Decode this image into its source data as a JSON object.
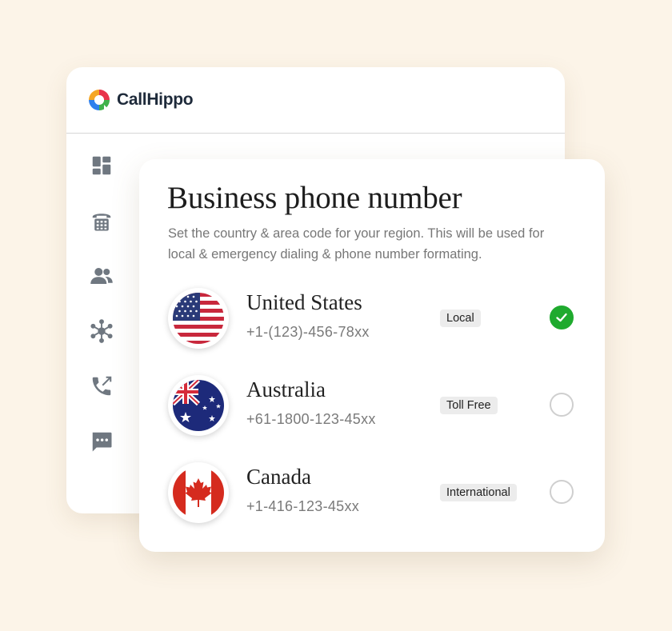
{
  "app": {
    "brand": "CallHippo",
    "brand_colors": [
      "#e8334a",
      "#f5a623",
      "#3fb24b",
      "#2f80ed"
    ],
    "sidebar": {
      "items": [
        {
          "icon": "dashboard-icon"
        },
        {
          "icon": "dialpad-phone-icon"
        },
        {
          "icon": "contacts-icon"
        },
        {
          "icon": "integrations-hub-icon"
        },
        {
          "icon": "call-logs-icon"
        },
        {
          "icon": "sms-chat-icon"
        }
      ],
      "icon_color": "#6f7780"
    }
  },
  "card": {
    "title": "Business phone number",
    "description": "Set the country & area code for your region. This will be used for local & emergency dialing & phone number formating.",
    "countries": [
      {
        "name": "United States",
        "number": "+1-(123)-456-78xx",
        "type": "Local",
        "selected": true,
        "flag": "us-flag-icon"
      },
      {
        "name": "Australia",
        "number": "+61-1800-123-45xx",
        "type": "Toll Free",
        "selected": false,
        "flag": "au-flag-icon"
      },
      {
        "name": "Canada",
        "number": "+1-416-123-45xx",
        "type": "International",
        "selected": false,
        "flag": "ca-flag-icon"
      }
    ],
    "selected_color": "#1faa2e"
  }
}
